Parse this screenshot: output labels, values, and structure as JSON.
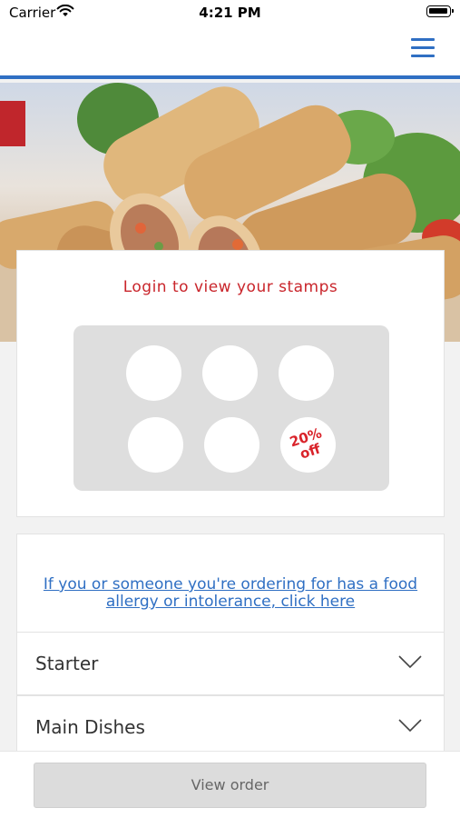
{
  "status_bar": {
    "carrier": "Carrier",
    "time": "4:21 PM",
    "wifi_icon": "wifi-icon",
    "battery_icon": "battery-icon"
  },
  "nav": {
    "menu_icon": "hamburger-menu-icon",
    "accent_color": "#2f6fc3"
  },
  "hero": {
    "image_subject": "spring rolls photo"
  },
  "stamps": {
    "title": "Login to view your stamps",
    "title_color": "#c9252b",
    "total_slots": 6,
    "filled_slots": 0,
    "reward_text_line1": "20%",
    "reward_text_line2": "off"
  },
  "allergy": {
    "link_text": "If you or someone you're ordering for has a food allergy or intolerance, click here"
  },
  "menu": {
    "categories": [
      {
        "label": "Starter"
      },
      {
        "label": "Main Dishes"
      }
    ],
    "expand_icon": "chevron-down-icon"
  },
  "footer": {
    "view_order_label": "View order"
  }
}
